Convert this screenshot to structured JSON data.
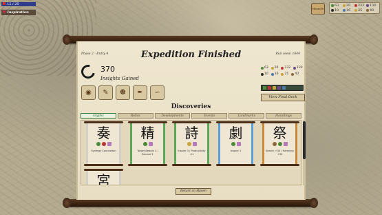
{
  "hud": {
    "status_title": "Inspiration",
    "progress_text": "12 / 20"
  },
  "resources": {
    "building_label": "Hexacle",
    "items": [
      {
        "value": "63",
        "color": "#4a8a3a"
      },
      {
        "value": "20",
        "color": "#c9a23a"
      },
      {
        "value": "232",
        "color": "#b33"
      },
      {
        "value": "130",
        "color": "#6a4a8a"
      },
      {
        "value": "10",
        "color": "#2a2a2a"
      },
      {
        "value": "16",
        "color": "#4a7aa8"
      },
      {
        "value": "25",
        "color": "#c9a23a"
      },
      {
        "value": "40",
        "color": "#8a6a3a"
      }
    ]
  },
  "panel": {
    "phase": "Phase 2 - Entry 4",
    "seed": "Run seed: 1644",
    "title": "Expedition Finished",
    "insights_value": "370",
    "insights_label": "Insights Gained",
    "stats": [
      {
        "value": "63",
        "color": "#4a8a3a"
      },
      {
        "value": "20",
        "color": "#c9a23a"
      },
      {
        "value": "232",
        "color": "#b33"
      },
      {
        "value": "130",
        "color": "#6a4a8a"
      },
      {
        "value": "10",
        "color": "#2a2a2a"
      },
      {
        "value": "16",
        "color": "#4a7aa8"
      },
      {
        "value": "25",
        "color": "#c9a23a"
      },
      {
        "value": "40",
        "color": "#8a6a3a"
      }
    ],
    "view_deck": "View Final Deck",
    "discoveries": "Discoveries",
    "tabs": [
      "Glyphs",
      "Relics",
      "Developments",
      "Events",
      "Landmarks",
      "Hauntings"
    ],
    "return": "Return to Haven"
  },
  "cards": [
    {
      "glyph": "奏",
      "border": "#d3cfc5",
      "desc": "Synergy Connection",
      "icons": [
        "#4a8a3a",
        "#b33"
      ]
    },
    {
      "glyph": "精",
      "border": "#5aa85a",
      "desc": "Target Beauty 2 / Discard 1",
      "icons": [
        "#4a8a3a"
      ]
    },
    {
      "glyph": "詩",
      "border": "#5aa85a",
      "desc": "Inspire 3 / Productivity -11",
      "icons": [
        "#c9a23a"
      ]
    },
    {
      "glyph": "劇",
      "border": "#5aa0d8",
      "desc": "Inspire 1",
      "icons": [
        "#4a8a3a"
      ]
    },
    {
      "glyph": "祭",
      "border": "#c88a3a",
      "desc": "Search +30 / Harmony +30",
      "icons": [
        "#8a6a3a",
        "#4a8a3a"
      ]
    },
    {
      "glyph": "宮",
      "border": "#d3cfc5",
      "desc": "",
      "icons": []
    }
  ]
}
